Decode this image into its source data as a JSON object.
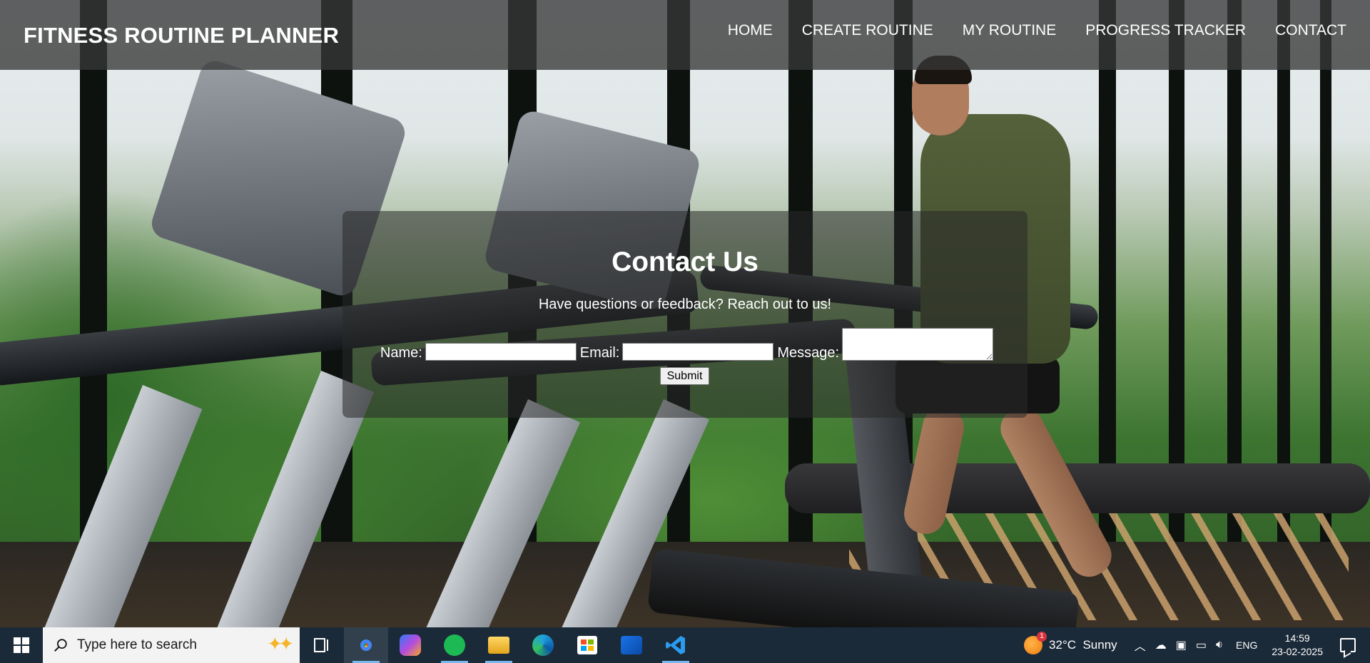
{
  "header": {
    "brand": "FITNESS ROUTINE PLANNER",
    "nav": [
      "HOME",
      "CREATE ROUTINE",
      "MY ROUTINE",
      "PROGRESS TRACKER",
      "CONTACT"
    ]
  },
  "contact": {
    "title": "Contact Us",
    "subtitle": "Have questions or feedback? Reach out to us!",
    "name_label": "Name:",
    "email_label": "Email:",
    "message_label": "Message:",
    "name_value": "",
    "email_value": "",
    "message_value": "",
    "submit_label": "Submit"
  },
  "taskbar": {
    "search_placeholder": "Type here to search",
    "apps": [
      "chrome-icon",
      "copilot-icon",
      "spotify-icon",
      "file-explorer-icon",
      "edge-icon",
      "microsoft-store-icon",
      "outlook-icon",
      "vscode-icon"
    ],
    "weather_badge": "1",
    "weather": "32°C  Sunny",
    "language": "ENG",
    "time": "14:59",
    "date": "23-02-2025"
  },
  "colors": {
    "header_overlay": "#373737",
    "taskbar": "#1b2a38",
    "active_indicator": "#76b9ed"
  }
}
